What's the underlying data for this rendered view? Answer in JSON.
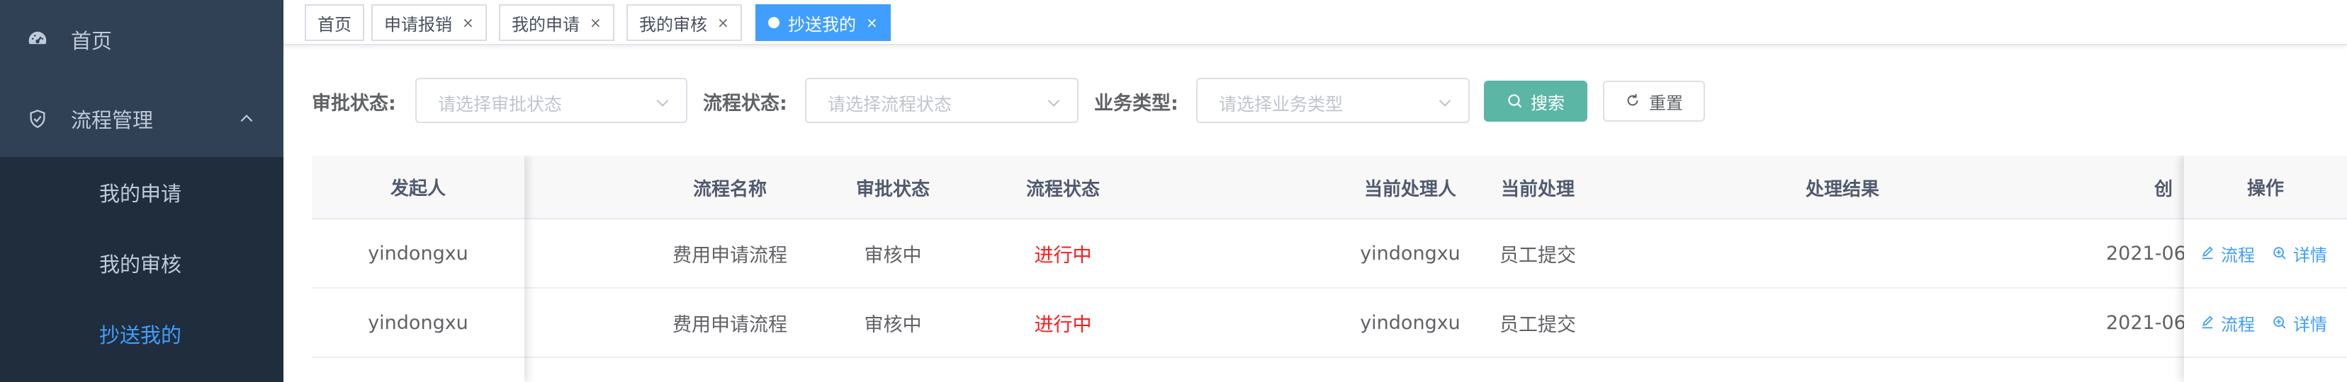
{
  "sidebar": {
    "items": [
      {
        "label": "首页",
        "icon": "dashboard-icon"
      },
      {
        "label": "流程管理",
        "icon": "shield-check-icon",
        "expanded": true
      }
    ],
    "submenu": [
      {
        "label": "我的申请",
        "active": false
      },
      {
        "label": "我的审核",
        "active": false
      },
      {
        "label": "抄送我的",
        "active": true
      }
    ],
    "colors": {
      "bg": "#304156",
      "submenu_bg": "#1f2d3d",
      "text": "#bfcbd9",
      "active": "#409eff"
    }
  },
  "tags": [
    {
      "label": "首页",
      "closable": false,
      "active": false
    },
    {
      "label": "申请报销",
      "closable": true,
      "active": false
    },
    {
      "label": "我的申请",
      "closable": true,
      "active": false
    },
    {
      "label": "我的审核",
      "closable": true,
      "active": false
    },
    {
      "label": "抄送我的",
      "closable": true,
      "active": true
    }
  ],
  "tag_close_glyph": "×",
  "filters": [
    {
      "label": "审批状态:",
      "placeholder": "请选择审批状态"
    },
    {
      "label": "流程状态:",
      "placeholder": "请选择流程状态"
    },
    {
      "label": "业务类型:",
      "placeholder": "请选择业务类型"
    }
  ],
  "buttons": {
    "search": "搜索",
    "reset": "重置",
    "search_color": "#5cb6a6"
  },
  "table": {
    "columns": [
      "发起人",
      "流程名称",
      "审批状态",
      "流程状态",
      "当前处理人",
      "当前处理",
      "处理结果",
      "创",
      "操作"
    ],
    "rows": [
      {
        "initiator": "yindongxu",
        "flow_name": "费用申请流程",
        "approval_status": "审核中",
        "flow_status": "进行中",
        "handler": "yindongxu",
        "current": "员工提交",
        "result": "",
        "created": "2021-06"
      },
      {
        "initiator": "yindongxu",
        "flow_name": "费用申请流程",
        "approval_status": "审核中",
        "flow_status": "进行中",
        "handler": "yindongxu",
        "current": "员工提交",
        "result": "",
        "created": "2021-06"
      }
    ],
    "actions": {
      "flow": "流程",
      "detail": "详情"
    },
    "status_color": "#ff1a1a"
  }
}
